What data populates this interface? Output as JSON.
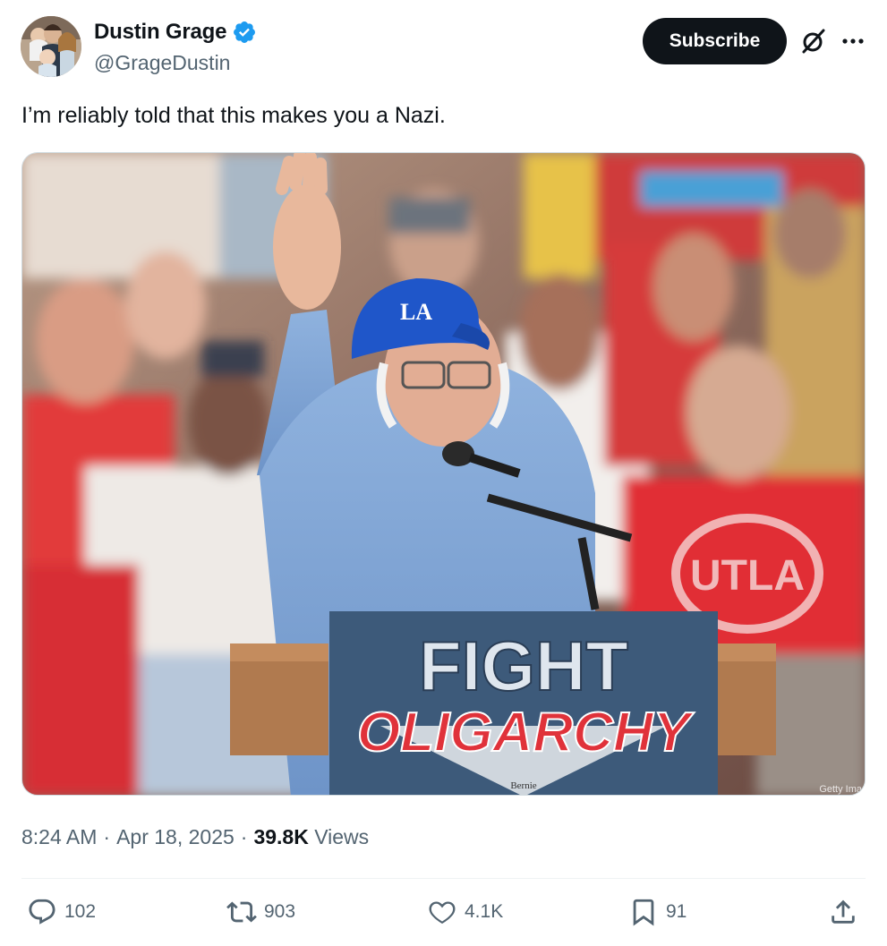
{
  "author": {
    "display_name": "Dustin Grage",
    "handle": "@GrageDustin",
    "verified": true
  },
  "header": {
    "subscribe_label": "Subscribe",
    "icons": [
      "grok-icon",
      "more-icon"
    ]
  },
  "tweet": {
    "text": "I’m reliably told that this makes you a Nazi.",
    "time": "8:24 AM",
    "date": "Apr 18, 2025",
    "views_count": "39.8K",
    "views_label": "Views"
  },
  "image_text": {
    "sign_line1": "FIGHT",
    "sign_line2": "OLIGARCHY",
    "sign_small": "Bernie",
    "cap_logo": "LA",
    "shirt_text": "UTLA",
    "watermark": "Getty Ima"
  },
  "actions": {
    "replies": "102",
    "reposts": "903",
    "likes": "4.1K",
    "bookmarks": "91"
  },
  "colors": {
    "accent": "#1d9bf0",
    "text": "#0f1419",
    "muted": "#536471",
    "button_bg": "#0f1419"
  }
}
